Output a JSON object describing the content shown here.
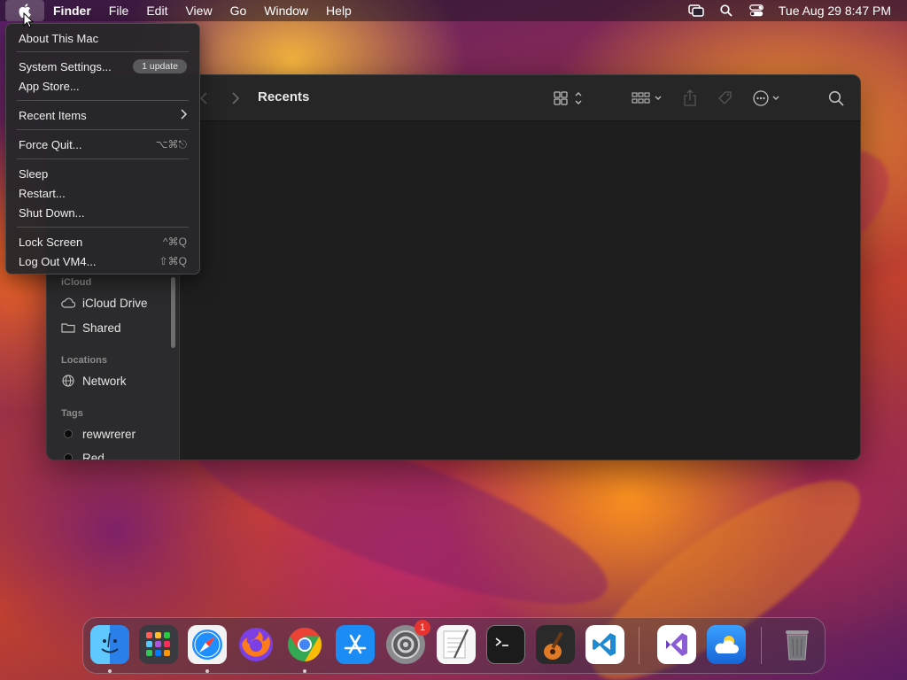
{
  "menubar": {
    "app_name": "Finder",
    "menus": [
      "File",
      "Edit",
      "View",
      "Go",
      "Window",
      "Help"
    ],
    "clock": "Tue Aug 29  8:47 PM",
    "status_icons": [
      "screen-mirroring-icon",
      "spotlight-search-icon",
      "control-center-icon"
    ]
  },
  "apple_menu": {
    "items": [
      {
        "label": "About This Mac"
      },
      {
        "label": "System Settings...",
        "badge": "1 update"
      },
      {
        "label": "App Store..."
      },
      {
        "label": "Recent Items",
        "submenu": true
      },
      {
        "label": "Force Quit...",
        "shortcut": "⌥⌘⎋"
      },
      {
        "label": "Sleep"
      },
      {
        "label": "Restart..."
      },
      {
        "label": "Shut Down..."
      },
      {
        "label": "Lock Screen",
        "shortcut": "^⌘Q"
      },
      {
        "label": "Log Out VM4...",
        "shortcut": "⇧⌘Q"
      }
    ]
  },
  "finder": {
    "title": "Recents",
    "sidebar": {
      "icloud_header": "iCloud",
      "icloud_items": [
        "iCloud Drive",
        "Shared"
      ],
      "locations_header": "Locations",
      "locations_items": [
        "Network"
      ],
      "tags_header": "Tags",
      "tags_items": [
        "rewwrerer",
        "Red"
      ]
    }
  },
  "dock": {
    "apps": [
      "finder-icon",
      "launchpad-icon",
      "safari-icon",
      "firefox-icon",
      "chrome-icon",
      "app-store-icon",
      "system-settings-icon",
      "textedit-icon",
      "terminal-icon",
      "garageband-icon",
      "vscode-icon",
      "visual-studio-icon",
      "weather-icon",
      "trash-icon"
    ],
    "system_settings_badge": "1"
  },
  "colors": {
    "accent": "#0a84ff",
    "badge_red": "#e5342f"
  }
}
